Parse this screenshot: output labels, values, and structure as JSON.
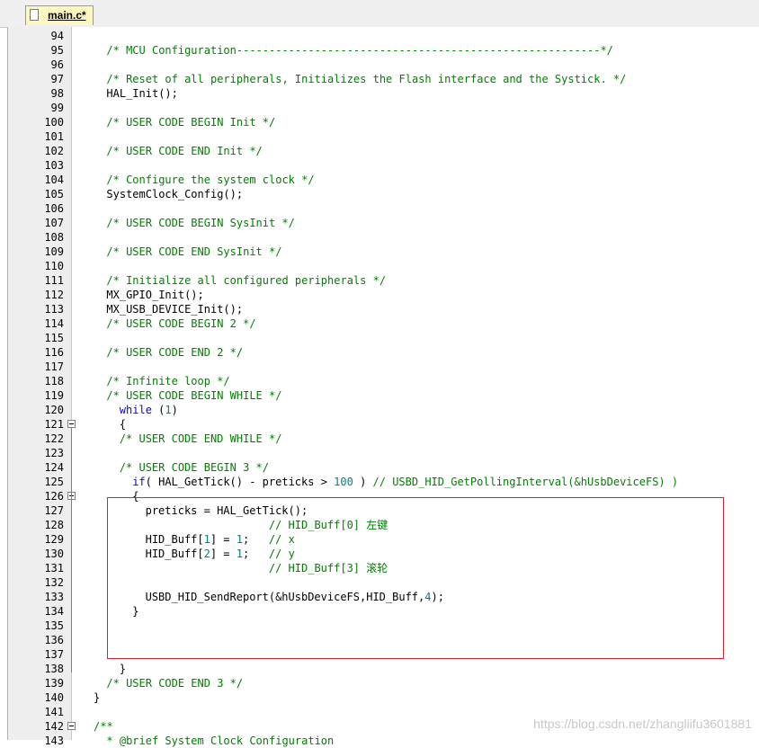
{
  "tab": {
    "label": "main.c*"
  },
  "lines": [
    {
      "n": "94",
      "indent": 0,
      "parts": []
    },
    {
      "n": "95",
      "indent": 2,
      "parts": [
        {
          "t": "c",
          "v": "/* MCU Configuration--------------------------------------------------------*/"
        }
      ]
    },
    {
      "n": "96",
      "indent": 0,
      "parts": []
    },
    {
      "n": "97",
      "indent": 2,
      "parts": [
        {
          "t": "c",
          "v": "/* Reset of all peripherals, Initializes the Flash interface and the Systick. */"
        }
      ]
    },
    {
      "n": "98",
      "indent": 2,
      "parts": [
        {
          "t": "p",
          "v": "HAL_Init();"
        }
      ]
    },
    {
      "n": "99",
      "indent": 0,
      "parts": []
    },
    {
      "n": "100",
      "indent": 2,
      "parts": [
        {
          "t": "c",
          "v": "/* USER CODE BEGIN Init */"
        }
      ]
    },
    {
      "n": "101",
      "indent": 0,
      "parts": []
    },
    {
      "n": "102",
      "indent": 2,
      "parts": [
        {
          "t": "c",
          "v": "/* USER CODE END Init */"
        }
      ]
    },
    {
      "n": "103",
      "indent": 0,
      "parts": []
    },
    {
      "n": "104",
      "indent": 2,
      "parts": [
        {
          "t": "c",
          "v": "/* Configure the system clock */"
        }
      ]
    },
    {
      "n": "105",
      "indent": 2,
      "parts": [
        {
          "t": "p",
          "v": "SystemClock_Config();"
        }
      ]
    },
    {
      "n": "106",
      "indent": 0,
      "parts": []
    },
    {
      "n": "107",
      "indent": 2,
      "parts": [
        {
          "t": "c",
          "v": "/* USER CODE BEGIN SysInit */"
        }
      ]
    },
    {
      "n": "108",
      "indent": 0,
      "parts": []
    },
    {
      "n": "109",
      "indent": 2,
      "parts": [
        {
          "t": "c",
          "v": "/* USER CODE END SysInit */"
        }
      ]
    },
    {
      "n": "110",
      "indent": 0,
      "parts": []
    },
    {
      "n": "111",
      "indent": 2,
      "parts": [
        {
          "t": "c",
          "v": "/* Initialize all configured peripherals */"
        }
      ]
    },
    {
      "n": "112",
      "indent": 2,
      "parts": [
        {
          "t": "p",
          "v": "MX_GPIO_Init();"
        }
      ]
    },
    {
      "n": "113",
      "indent": 2,
      "parts": [
        {
          "t": "p",
          "v": "MX_USB_DEVICE_Init();"
        }
      ]
    },
    {
      "n": "114",
      "indent": 2,
      "parts": [
        {
          "t": "c",
          "v": "/* USER CODE BEGIN 2 */"
        }
      ]
    },
    {
      "n": "115",
      "indent": 0,
      "parts": []
    },
    {
      "n": "116",
      "indent": 2,
      "parts": [
        {
          "t": "c",
          "v": "/* USER CODE END 2 */"
        }
      ]
    },
    {
      "n": "117",
      "indent": 0,
      "parts": []
    },
    {
      "n": "118",
      "indent": 2,
      "parts": [
        {
          "t": "c",
          "v": "/* Infinite loop */"
        }
      ]
    },
    {
      "n": "119",
      "indent": 2,
      "parts": [
        {
          "t": "c",
          "v": "/* USER CODE BEGIN WHILE */"
        }
      ]
    },
    {
      "n": "120",
      "indent": 4,
      "parts": [
        {
          "t": "k",
          "v": "while"
        },
        {
          "t": "p",
          "v": " ("
        },
        {
          "t": "n",
          "v": "1"
        },
        {
          "t": "p",
          "v": ")"
        }
      ]
    },
    {
      "n": "121",
      "indent": 4,
      "fold": true,
      "parts": [
        {
          "t": "p",
          "v": "{"
        }
      ]
    },
    {
      "n": "122",
      "indent": 4,
      "parts": [
        {
          "t": "c",
          "v": "/* USER CODE END WHILE */"
        }
      ]
    },
    {
      "n": "123",
      "indent": 0,
      "parts": []
    },
    {
      "n": "124",
      "indent": 4,
      "parts": [
        {
          "t": "c",
          "v": "/* USER CODE BEGIN 3 */"
        }
      ]
    },
    {
      "n": "125",
      "indent": 6,
      "parts": [
        {
          "t": "k",
          "v": "if"
        },
        {
          "t": "p",
          "v": "( HAL_GetTick() - preticks > "
        },
        {
          "t": "n",
          "v": "100"
        },
        {
          "t": "p",
          "v": " ) "
        },
        {
          "t": "c",
          "v": "// USBD_HID_GetPollingInterval(&hUsbDeviceFS) )"
        }
      ]
    },
    {
      "n": "126",
      "indent": 6,
      "fold": true,
      "parts": [
        {
          "t": "p",
          "v": "{"
        }
      ]
    },
    {
      "n": "127",
      "indent": 8,
      "parts": [
        {
          "t": "p",
          "v": "preticks = HAL_GetTick();"
        }
      ]
    },
    {
      "n": "128",
      "indent": 8,
      "parts": [
        {
          "t": "p",
          "v": "                   "
        },
        {
          "t": "c",
          "v": "// HID_Buff[0] 左键"
        }
      ]
    },
    {
      "n": "129",
      "indent": 8,
      "parts": [
        {
          "t": "p",
          "v": "HID_Buff["
        },
        {
          "t": "n",
          "v": "1"
        },
        {
          "t": "p",
          "v": "] = "
        },
        {
          "t": "n",
          "v": "1"
        },
        {
          "t": "p",
          "v": ";   "
        },
        {
          "t": "c",
          "v": "// x"
        }
      ]
    },
    {
      "n": "130",
      "indent": 8,
      "parts": [
        {
          "t": "p",
          "v": "HID_Buff["
        },
        {
          "t": "n",
          "v": "2"
        },
        {
          "t": "p",
          "v": "] = "
        },
        {
          "t": "n",
          "v": "1"
        },
        {
          "t": "p",
          "v": ";   "
        },
        {
          "t": "c",
          "v": "// y"
        }
      ]
    },
    {
      "n": "131",
      "indent": 8,
      "parts": [
        {
          "t": "p",
          "v": "                   "
        },
        {
          "t": "c",
          "v": "// HID_Buff[3] 滚轮"
        }
      ]
    },
    {
      "n": "132",
      "indent": 0,
      "parts": []
    },
    {
      "n": "133",
      "indent": 8,
      "parts": [
        {
          "t": "p",
          "v": "USBD_HID_SendReport(&hUsbDeviceFS,HID_Buff,"
        },
        {
          "t": "n",
          "v": "4"
        },
        {
          "t": "p",
          "v": ");"
        }
      ]
    },
    {
      "n": "134",
      "indent": 6,
      "parts": [
        {
          "t": "p",
          "v": "}"
        }
      ]
    },
    {
      "n": "135",
      "indent": 0,
      "parts": []
    },
    {
      "n": "136",
      "indent": 0,
      "parts": []
    },
    {
      "n": "137",
      "indent": 0,
      "parts": []
    },
    {
      "n": "138",
      "indent": 4,
      "parts": [
        {
          "t": "p",
          "v": "}"
        }
      ]
    },
    {
      "n": "139",
      "indent": 2,
      "parts": [
        {
          "t": "c",
          "v": "/* USER CODE END 3 */"
        }
      ]
    },
    {
      "n": "140",
      "indent": 0,
      "parts": [
        {
          "t": "p",
          "v": "}"
        }
      ]
    },
    {
      "n": "141",
      "indent": 0,
      "parts": []
    },
    {
      "n": "142",
      "indent": 0,
      "fold": true,
      "parts": [
        {
          "t": "c",
          "v": "/**"
        }
      ]
    },
    {
      "n": "143",
      "indent": 2,
      "parts": [
        {
          "t": "c",
          "v": "* @brief System Clock Configuration"
        }
      ]
    }
  ],
  "watermark": "https://blog.csdn.net/zhangliifu3601881",
  "colors": {
    "comment": "#008000",
    "keyword": "#0000ff",
    "number": "#008080",
    "highlight": "#e0202a"
  }
}
